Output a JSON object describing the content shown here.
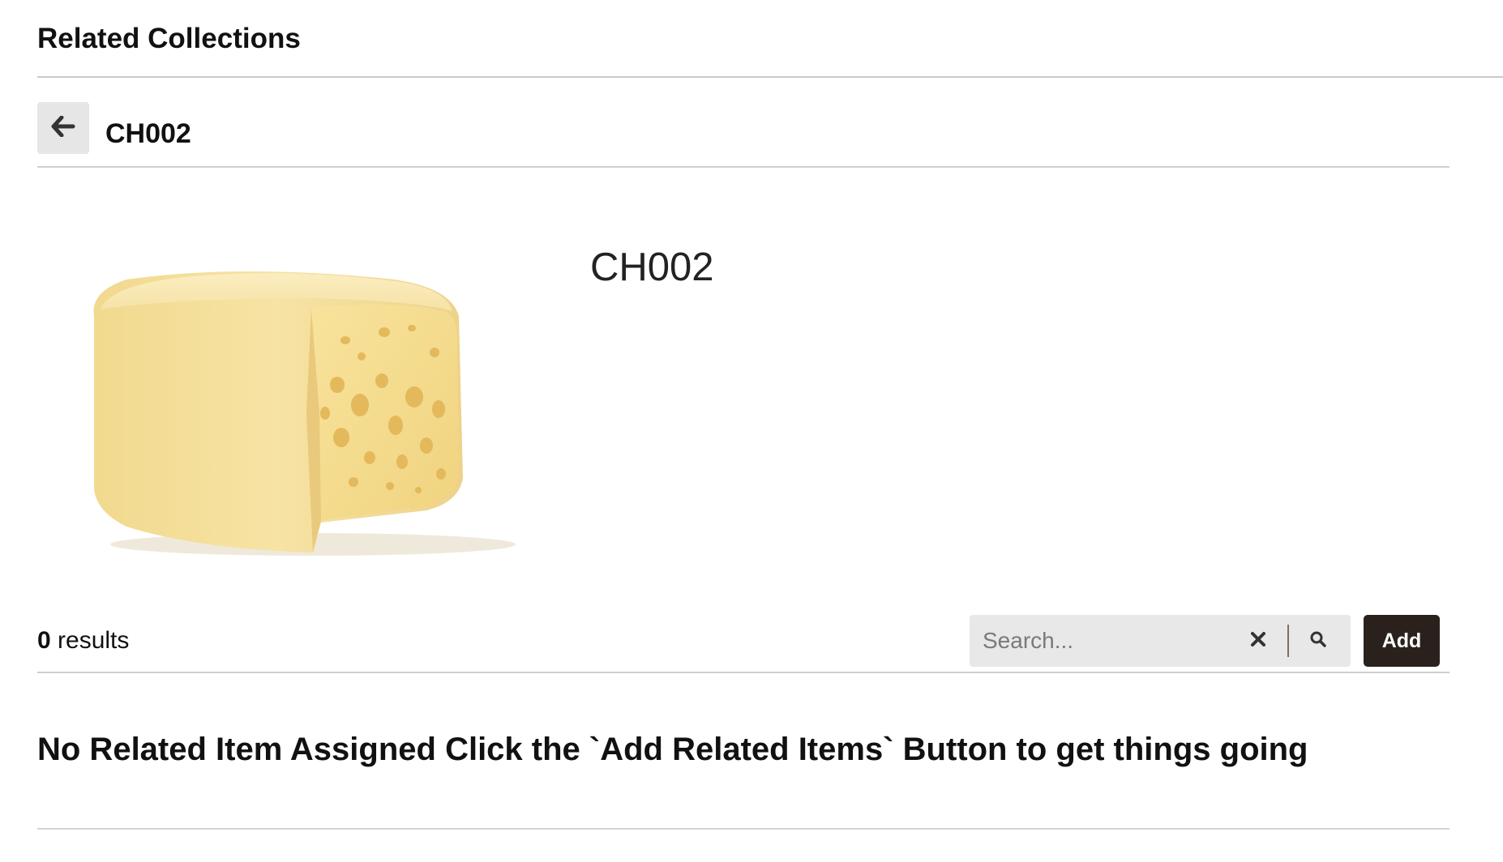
{
  "section": {
    "title": "Related Collections"
  },
  "header": {
    "back_icon": "arrow-left-icon",
    "title": "CH002"
  },
  "product": {
    "name": "CH002",
    "image_subject": "swiss-cheese-wheel"
  },
  "toolbar": {
    "result_count": "0",
    "result_label": " results",
    "search_placeholder": "Search...",
    "search_value": "",
    "clear_icon": "close-icon",
    "search_icon": "search-icon",
    "add_label": "Add",
    "add_button_color": "#2a211d"
  },
  "empty_state": {
    "message": "No Related Item Assigned Click the `Add Related Items` Button to get things going"
  }
}
